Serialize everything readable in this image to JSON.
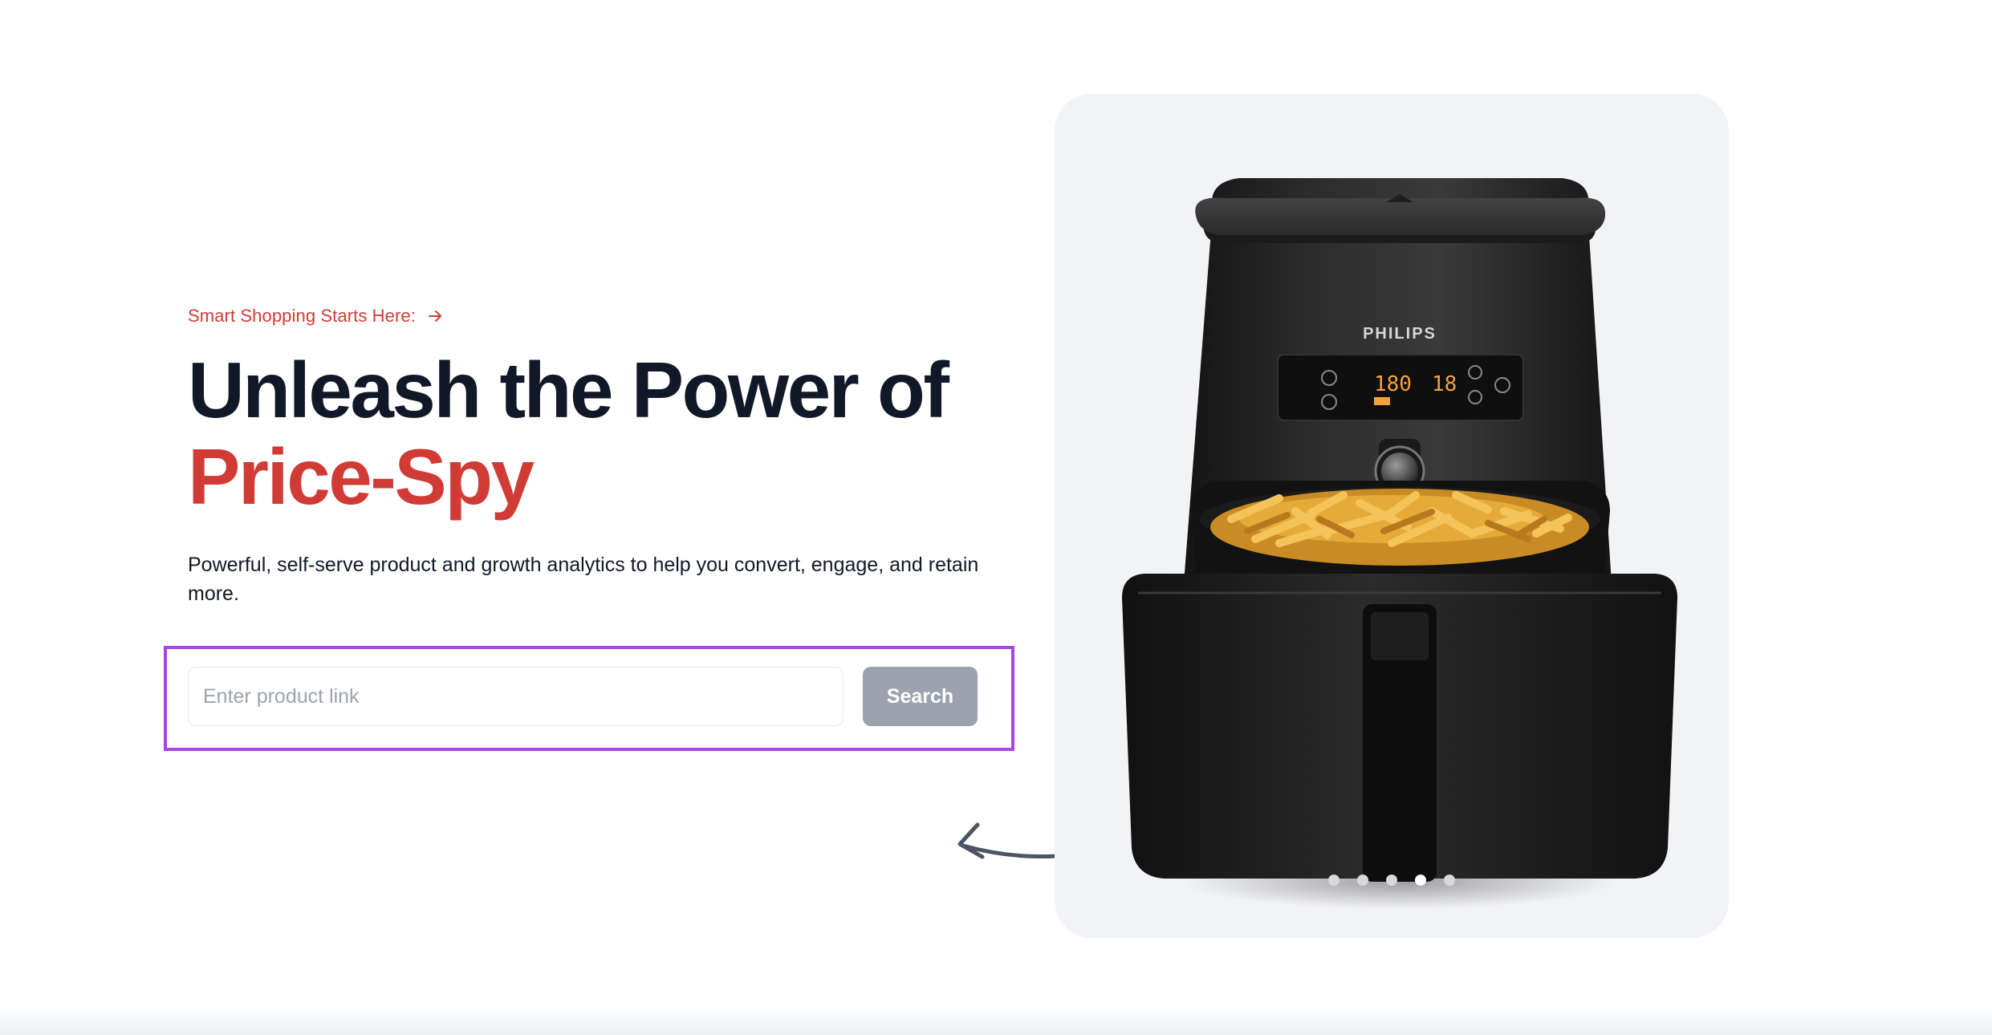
{
  "hero": {
    "eyebrow": "Smart Shopping Starts Here:",
    "eyebrow_icon": "arrow-right-icon",
    "headline_line1": "Unleash the Power of",
    "headline_line2": "Price-Spy",
    "description": "Powerful, self-serve product and growth analytics to help you convert, engage, and retain more."
  },
  "search": {
    "placeholder": "Enter product link",
    "value": "",
    "button_label": "Search"
  },
  "product_card": {
    "image": "philips-air-fryer-with-fries",
    "brand_text": "PHILIPS",
    "display_temp": "180",
    "display_time": "18",
    "carousel": {
      "count": 5,
      "active_index": 3
    }
  },
  "colors": {
    "accent": "#d13b35",
    "heading": "#111827",
    "highlight_frame": "#a845e6",
    "button_disabled": "#9ca3af",
    "card_bg": "#f2f3f7"
  }
}
